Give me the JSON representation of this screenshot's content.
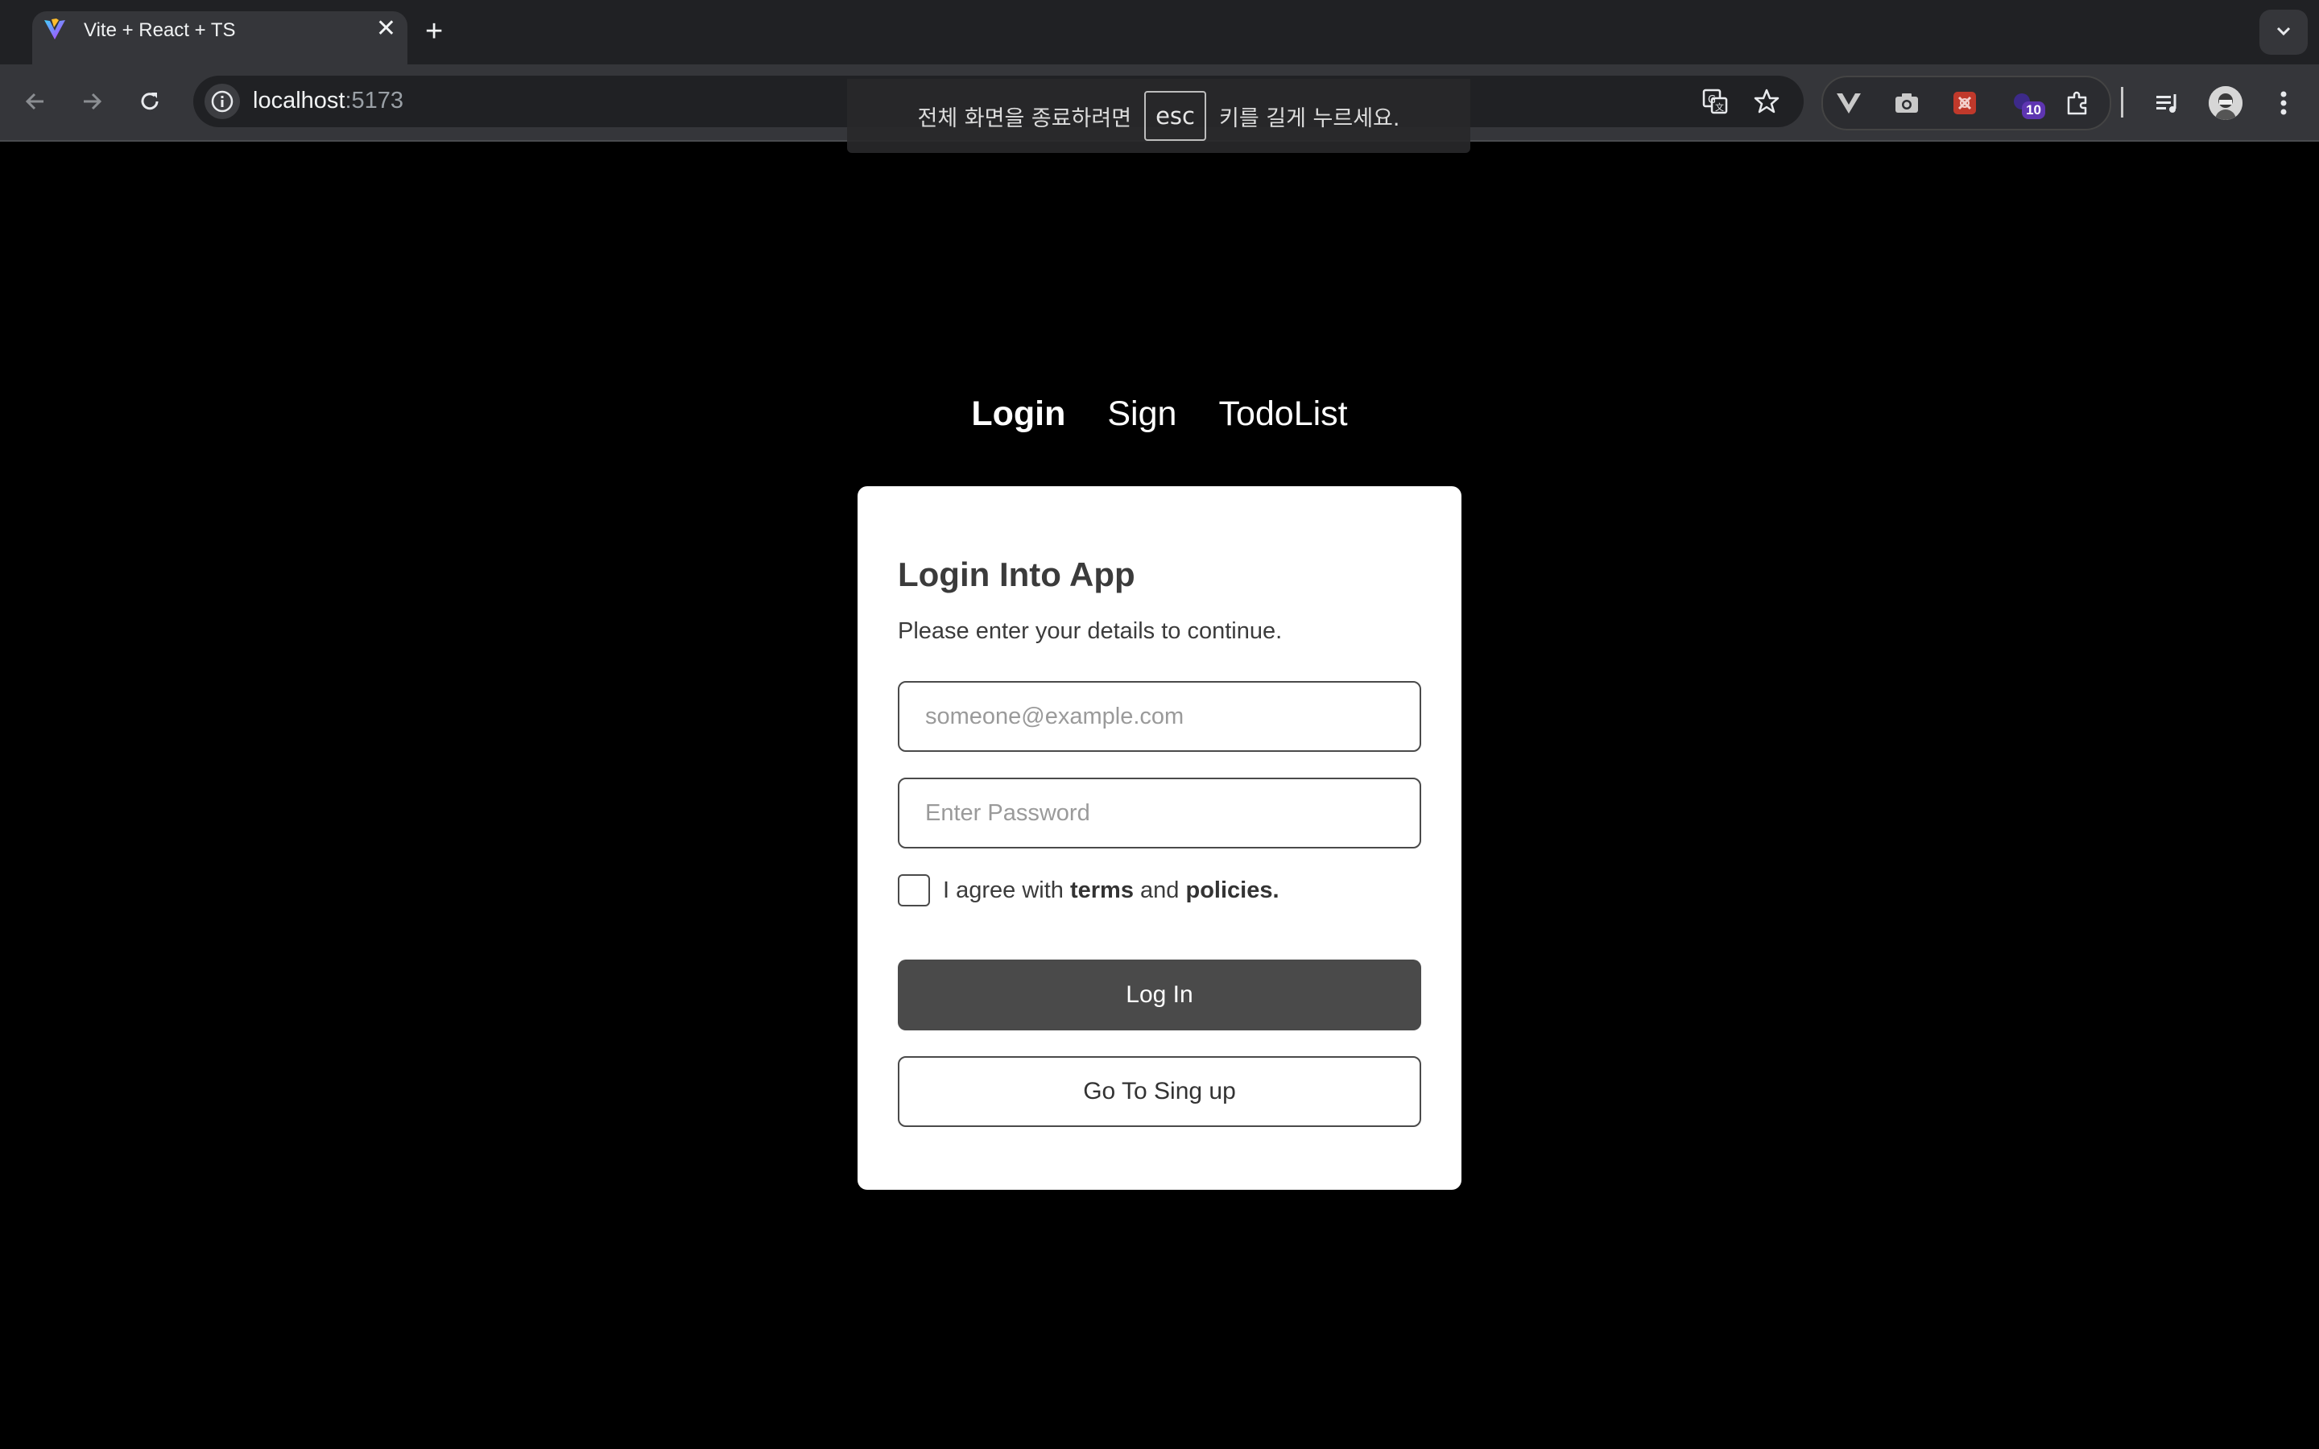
{
  "browser": {
    "tab_title": "Vite + React + TS",
    "tab_close": "✕",
    "new_tab": "+",
    "url_host": "localhost",
    "url_port": ":5173",
    "extension_badge": "10"
  },
  "fullscreen_notice": {
    "before": "전체 화면을 종료하려면",
    "key": "esc",
    "after": "키를 길게 누르세요."
  },
  "nav": {
    "items": [
      {
        "label": "Login",
        "active": true
      },
      {
        "label": "Sign",
        "active": false
      },
      {
        "label": "TodoList",
        "active": false
      }
    ]
  },
  "login": {
    "title": "Login Into App",
    "subtitle": "Please enter your details to continue.",
    "email_placeholder": "someone@example.com",
    "email_value": "",
    "password_placeholder": "Enter Password",
    "password_value": "",
    "agree_prefix": "I agree with",
    "agree_terms": "terms",
    "agree_and": "and",
    "agree_policies": "policies.",
    "agree_checked": false,
    "login_button": "Log In",
    "signup_button": "Go To Sing up"
  },
  "colors": {
    "page_background": "#000000",
    "card_background": "#ffffff",
    "primary_button": "#4a4a4a",
    "chrome_toolbar": "#35363a",
    "chrome_tabstrip": "#202124"
  }
}
